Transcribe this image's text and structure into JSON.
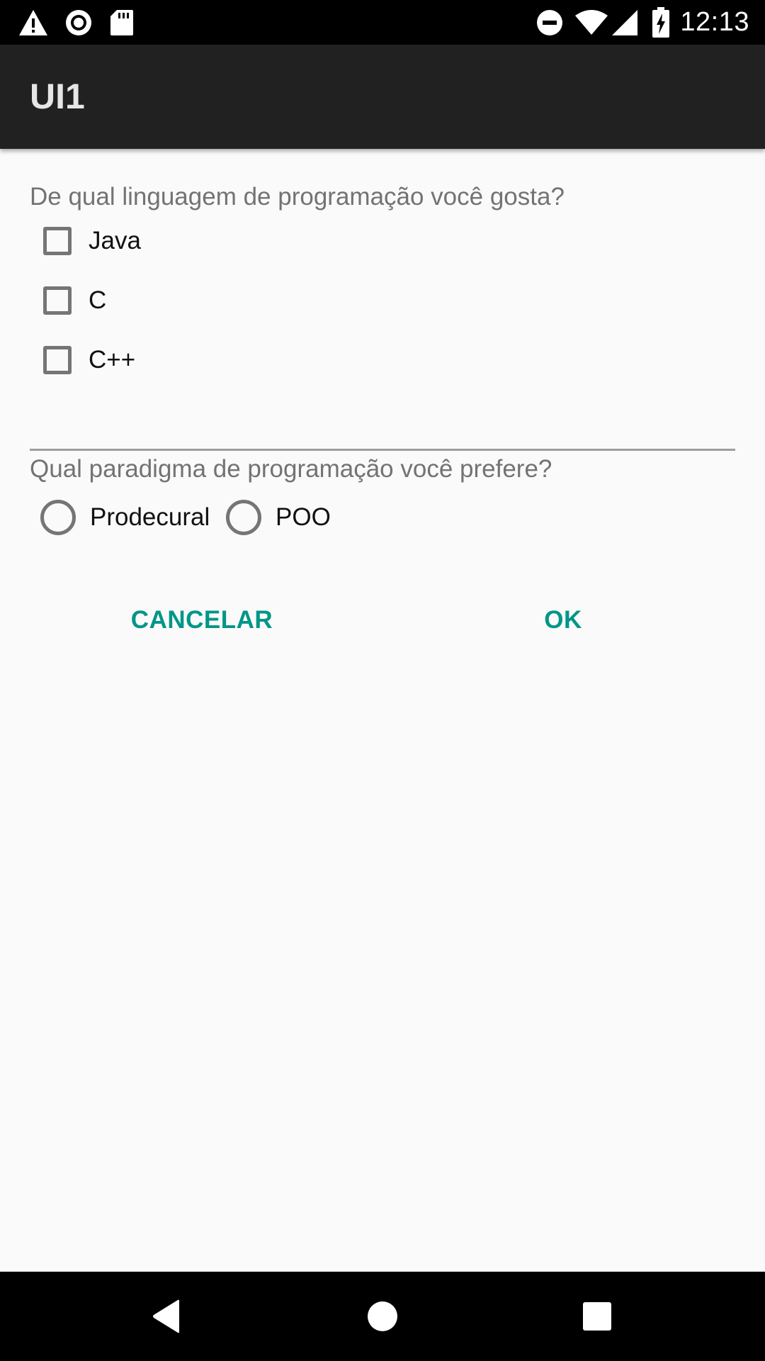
{
  "status_bar": {
    "time": "12:13",
    "icons_left": [
      "warning-icon",
      "record-icon",
      "sd-card-icon"
    ],
    "icons_right": [
      "do-not-disturb-icon",
      "wifi-icon",
      "signal-icon",
      "battery-charging-icon"
    ]
  },
  "app_bar": {
    "title": "UI1"
  },
  "language_question": {
    "label": "De qual linguagem de programação você gosta?",
    "options": [
      {
        "label": "Java",
        "checked": false
      },
      {
        "label": "C",
        "checked": false
      },
      {
        "label": "C++",
        "checked": false
      }
    ]
  },
  "paradigm_question": {
    "label": "Qual paradigma de programação você prefere?",
    "options": [
      {
        "label": "Prodecural",
        "selected": false
      },
      {
        "label": "POO",
        "selected": false
      }
    ]
  },
  "actions": {
    "cancel_label": "CANCELAR",
    "ok_label": "OK"
  },
  "colors": {
    "accent": "#009688",
    "app_bar": "#212121",
    "background": "#fafafa"
  },
  "nav_bar": {
    "buttons": [
      "back-icon",
      "home-icon",
      "recents-icon"
    ]
  }
}
